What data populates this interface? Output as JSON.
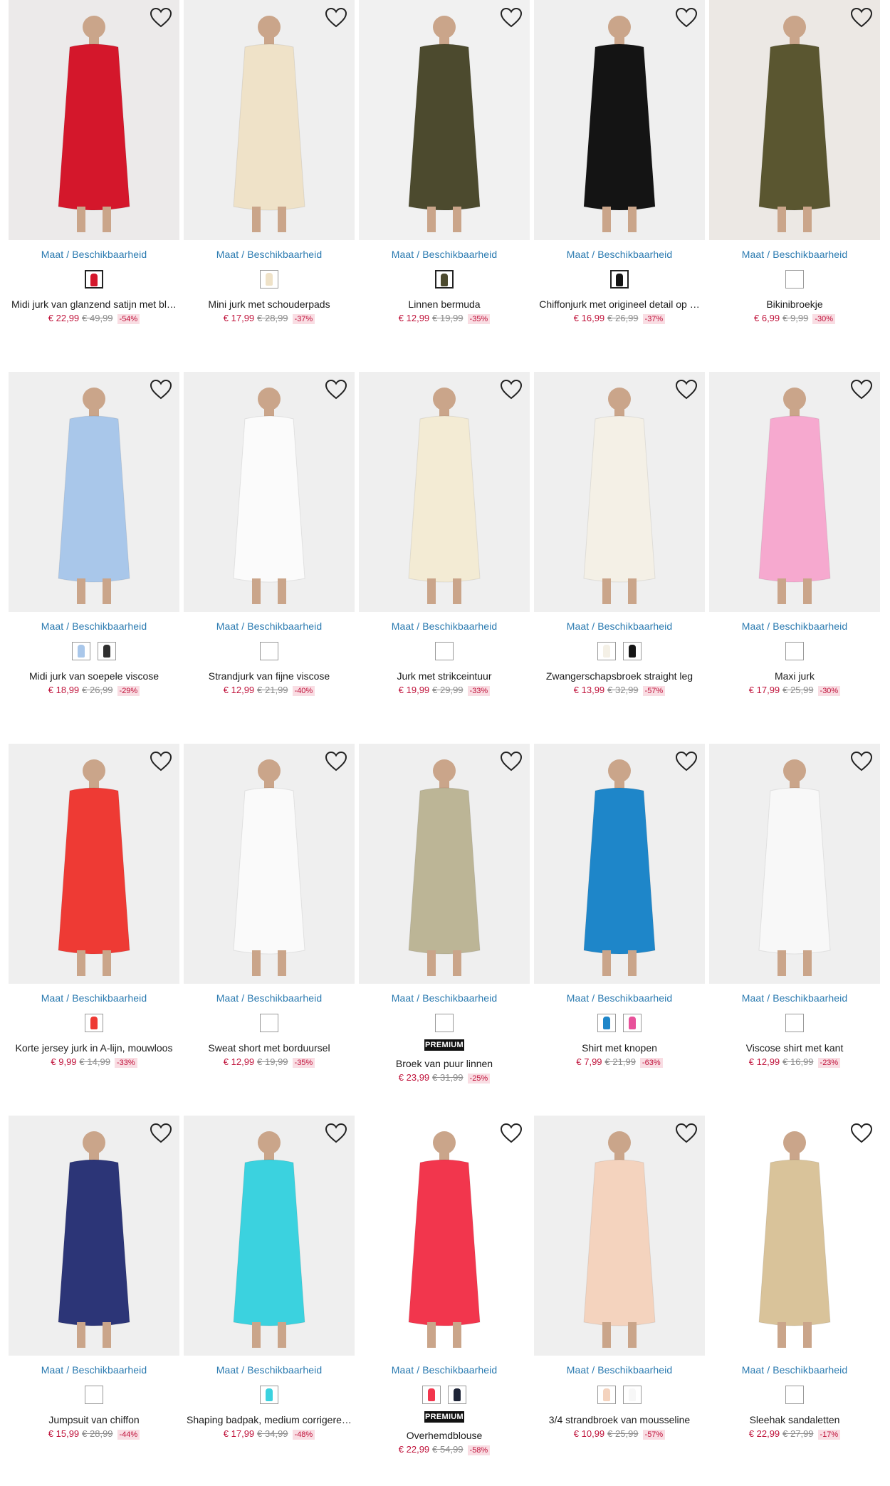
{
  "size_link_label": "Maat / Beschikbaarheid",
  "premium_label": "PREMIUM",
  "rows": [
    [
      {
        "name": "Midi jurk van glanzend satijn met bl…",
        "price": "€ 22,99",
        "old_price": "€ 49,99",
        "discount": "-54%",
        "bg": "#eceaea",
        "figure": "#d4172b",
        "swatches": [
          {
            "color": "#d4172b",
            "selected": true
          }
        ]
      },
      {
        "name": "Mini jurk met schouderpads",
        "price": "€ 17,99",
        "old_price": "€ 28,99",
        "discount": "-37%",
        "bg": "#efefef",
        "figure": "#efe2c8",
        "swatches": [
          {
            "color": "#efe2c8",
            "selected": false
          }
        ]
      },
      {
        "name": "Linnen bermuda",
        "price": "€ 12,99",
        "old_price": "€ 19,99",
        "discount": "-35%",
        "bg": "#f1f1f1",
        "figure": "#4c4a2e",
        "swatches": [
          {
            "color": "#4c4a2e",
            "selected": true
          }
        ]
      },
      {
        "name": "Chiffonjurk met origineel detail op …",
        "price": "€ 16,99",
        "old_price": "€ 26,99",
        "discount": "-37%",
        "bg": "#efefef",
        "figure": "#141414",
        "swatches": [
          {
            "color": "#141414",
            "selected": true
          }
        ]
      },
      {
        "name": "Bikinibroekje",
        "price": "€ 6,99",
        "old_price": "€ 9,99",
        "discount": "-30%",
        "bg": "#ece8e4",
        "figure": "#5a5630",
        "swatches": [
          {
            "color": "",
            "selected": false
          }
        ]
      }
    ],
    [
      {
        "name": "Midi jurk van soepele viscose",
        "price": "€ 18,99",
        "old_price": "€ 26,99",
        "discount": "-29%",
        "bg": "#efefef",
        "figure": "#a9c7ea",
        "swatches": [
          {
            "color": "#a9c7ea",
            "selected": false
          },
          {
            "color": "#2f2f2f",
            "selected": false
          }
        ]
      },
      {
        "name": "Strandjurk van fijne viscose",
        "price": "€ 12,99",
        "old_price": "€ 21,99",
        "discount": "-40%",
        "bg": "#efefef",
        "figure": "#fbfbfb",
        "swatches": [
          {
            "color": "",
            "selected": false
          }
        ]
      },
      {
        "name": "Jurk met strikceintuur",
        "price": "€ 19,99",
        "old_price": "€ 29,99",
        "discount": "-33%",
        "bg": "#efefef",
        "figure": "#f3ebd4",
        "swatches": [
          {
            "color": "",
            "selected": false
          }
        ]
      },
      {
        "name": "Zwangerschapsbroek straight leg",
        "price": "€ 13,99",
        "old_price": "€ 32,99",
        "discount": "-57%",
        "bg": "#efefef",
        "figure": "#f4f0e6",
        "swatches": [
          {
            "color": "#f4f0e6",
            "selected": false
          },
          {
            "color": "#151515",
            "selected": false
          }
        ]
      },
      {
        "name": "Maxi jurk",
        "price": "€ 17,99",
        "old_price": "€ 25,99",
        "discount": "-30%",
        "bg": "#efefef",
        "figure": "#f6a9cf",
        "swatches": [
          {
            "color": "",
            "selected": false
          }
        ]
      }
    ],
    [
      {
        "name": "Korte jersey jurk in A-lijn, mouwloos",
        "price": "€ 9,99",
        "old_price": "€ 14,99",
        "discount": "-33%",
        "bg": "#efefef",
        "figure": "#ee3a34",
        "swatches": [
          {
            "color": "#ee3a34",
            "selected": false
          }
        ]
      },
      {
        "name": "Sweat short met borduursel",
        "price": "€ 12,99",
        "old_price": "€ 19,99",
        "discount": "-35%",
        "bg": "#efefef",
        "figure": "#fafafa",
        "swatches": [
          {
            "color": "",
            "selected": false
          }
        ]
      },
      {
        "name": "Broek van puur linnen",
        "price": "€ 23,99",
        "old_price": "€ 31,99",
        "discount": "-25%",
        "bg": "#efefef",
        "figure": "#bcb596",
        "premium": true,
        "swatches": [
          {
            "color": "",
            "selected": false
          }
        ]
      },
      {
        "name": "Shirt met knopen",
        "price": "€ 7,99",
        "old_price": "€ 21,99",
        "discount": "-63%",
        "bg": "#efefef",
        "figure": "#1e86c9",
        "swatches": [
          {
            "color": "#1e86c9",
            "selected": false
          },
          {
            "color": "#e8519a",
            "selected": false
          }
        ]
      },
      {
        "name": "Viscose shirt met kant",
        "price": "€ 12,99",
        "old_price": "€ 16,99",
        "discount": "-23%",
        "bg": "#efefef",
        "figure": "#f8f8f8",
        "swatches": [
          {
            "color": "",
            "selected": false
          }
        ]
      }
    ],
    [
      {
        "name": "Jumpsuit van chiffon",
        "price": "€ 15,99",
        "old_price": "€ 28,99",
        "discount": "-44%",
        "bg": "#efefef",
        "figure": "#2c3577",
        "swatches": [
          {
            "color": "",
            "selected": false
          }
        ]
      },
      {
        "name": "Shaping badpak, medium corrigerend",
        "price": "€ 17,99",
        "old_price": "€ 34,99",
        "discount": "-48%",
        "bg": "#efefef",
        "figure": "#3bd2df",
        "swatches": [
          {
            "color": "#3bd2df",
            "selected": false
          }
        ]
      },
      {
        "name": "Overhemdblouse",
        "price": "€ 22,99",
        "old_price": "€ 54,99",
        "discount": "-58%",
        "bg": "#ffffff",
        "figure": "#f2364d",
        "premium": true,
        "swatches": [
          {
            "color": "#f2364d",
            "selected": false
          },
          {
            "color": "#1e2437",
            "selected": false
          }
        ]
      },
      {
        "name": "3/4 strandbroek van mousseline",
        "price": "€ 10,99",
        "old_price": "€ 25,99",
        "discount": "-57%",
        "bg": "#efefef",
        "figure": "#f4d3be",
        "swatches": [
          {
            "color": "#f4d3be",
            "selected": false
          },
          {
            "color": "#f7f7f7",
            "selected": false
          }
        ]
      },
      {
        "name": "Sleehak sandaletten",
        "price": "€ 22,99",
        "old_price": "€ 27,99",
        "discount": "-17%",
        "bg": "#ffffff",
        "figure": "#d9c39a",
        "swatches": [
          {
            "color": "",
            "selected": false
          }
        ]
      }
    ]
  ]
}
